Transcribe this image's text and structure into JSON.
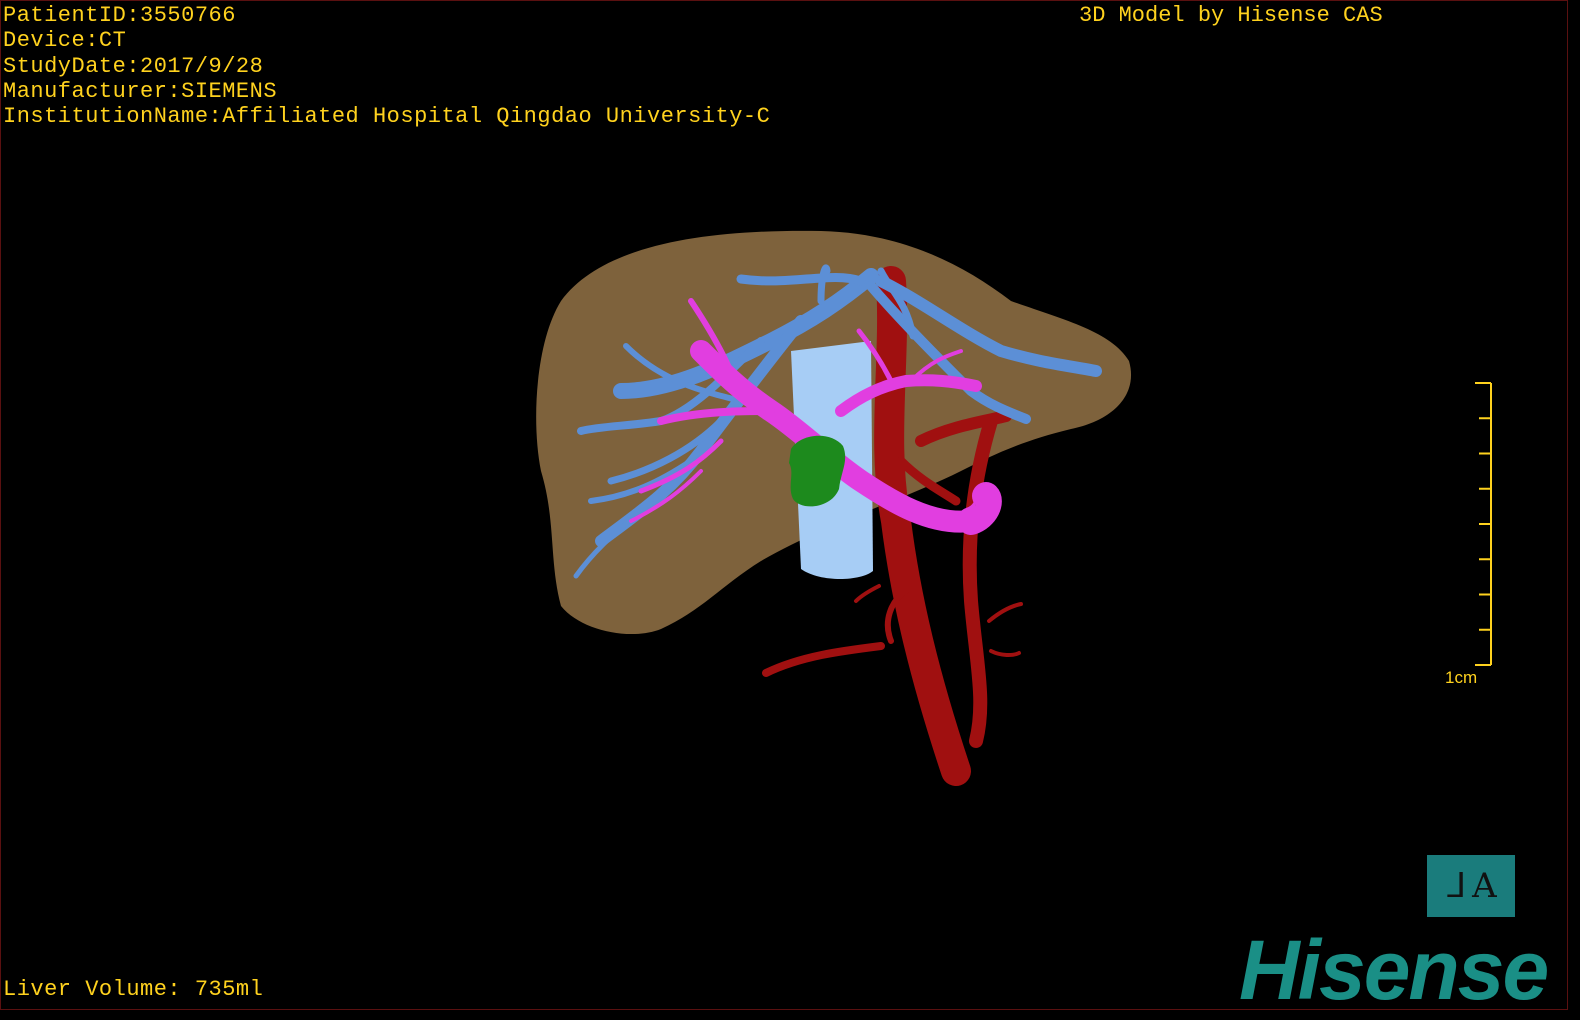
{
  "info": {
    "patient_id": "PatientID:3550766",
    "device": "Device:CT",
    "study_date": "StudyDate:2017/9/28",
    "manufacturer": "Manufacturer:SIEMENS",
    "institution": "InstitutionName:Affiliated Hospital Qingdao University-C"
  },
  "credit": "3D Model by Hisense CAS",
  "liver_volume": "Liver Volume: 735ml",
  "scale_bar": {
    "label": "1cm"
  },
  "view_badge": {
    "left_glyph": "ᒧ",
    "right_glyph": "A"
  },
  "brand": {
    "name": "Hisense"
  },
  "colors": {
    "text": "#ffd21e",
    "liver": "#85673f",
    "hepatic_vein": "#5c8fd6",
    "portal_vein": "#e13ee0",
    "ivc": "#a7cdf5",
    "artery": "#a01010",
    "tumor": "#1d8a1d",
    "badge": "#1a7c7c",
    "brand": "#1a8f86"
  },
  "icons": {
    "view_badge": "orientation-reset-icon",
    "model": "liver-3d-model-icon"
  }
}
